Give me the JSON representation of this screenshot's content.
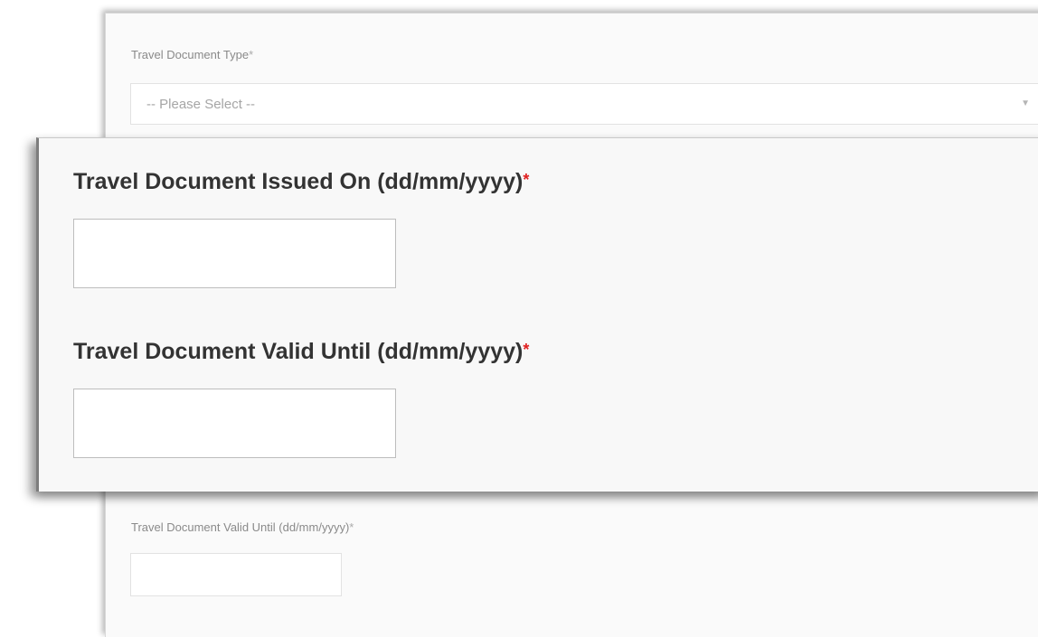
{
  "background_form": {
    "doc_type_label": "Travel Document Type",
    "required_mark": "*",
    "doc_type_select": {
      "selected": "-- Please Select --",
      "arrow": "▼"
    },
    "valid_until_label": "Travel Document Valid Until (dd/mm/yyyy)",
    "valid_until_value": ""
  },
  "zoomed_form": {
    "issued_on_label": "Travel Document Issued On (dd/mm/yyyy)",
    "issued_on_value": "",
    "valid_until_label": "Travel Document Valid Until (dd/mm/yyyy)",
    "valid_until_value": "",
    "required_mark": "*"
  },
  "colors": {
    "required": "#e02020",
    "label_text": "#333333",
    "faint_label": "#8a8a8a"
  }
}
